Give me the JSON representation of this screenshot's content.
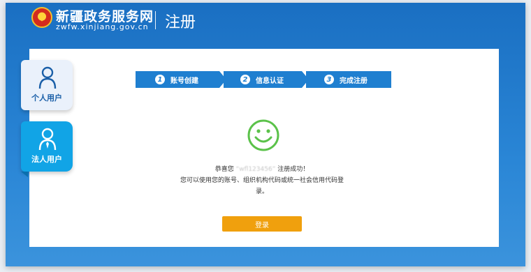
{
  "header": {
    "site_name": "新疆政务服务网",
    "site_domain": "zwfw.xinjiang.gov.cn",
    "page_title": "注册"
  },
  "tabs": [
    {
      "label": "个人用户",
      "active": false
    },
    {
      "label": "法人用户",
      "active": true
    }
  ],
  "steps": [
    {
      "num": "1",
      "label": "账号创建"
    },
    {
      "num": "2",
      "label": "信息认证"
    },
    {
      "num": "3",
      "label": "完成注册"
    }
  ],
  "result": {
    "prefix": "恭喜您",
    "account": "“wfl123456”",
    "suffix": "注册成功！",
    "line2": "您可以使用您的账号、组织机构代码或统一社会信用代码登",
    "line3": "录。"
  },
  "login_button": "登录",
  "colors": {
    "primary": "#1f7fd0",
    "accent": "#f0a00d",
    "success": "#5bc24a"
  }
}
